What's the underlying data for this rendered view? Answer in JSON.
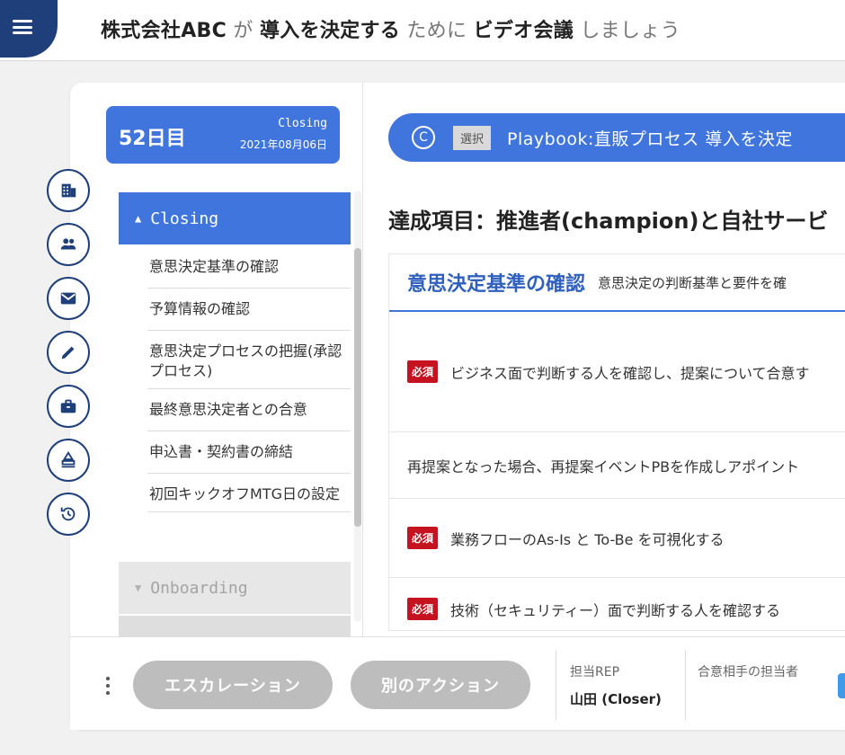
{
  "header": {
    "company": "株式会社ABC",
    "particle_ga": "が",
    "goal": "導入を決定する",
    "tameni": "ために",
    "action": "ビデオ会議",
    "suffix": "しましょう"
  },
  "rail_icons": [
    "building-icon",
    "people-icon",
    "mail-icon",
    "pencil-icon",
    "briefcase-icon",
    "stamp-icon",
    "history-icon"
  ],
  "day": {
    "count": "52日目",
    "phase": "Closing",
    "date": "2021年08月06日"
  },
  "phase_open": "Closing",
  "tasks": [
    "意思決定基準の確認",
    "予算情報の確認",
    "意思決定プロセスの把握(承認プロセス)",
    "最終意思決定者との合意",
    "申込書・契約書の締結",
    "初回キックオフMTG日の設定"
  ],
  "phase_next": "Onboarding",
  "playbook": {
    "circle_letter": "C",
    "select_tag": "選択",
    "text": "Playbook:直販プロセス  導入を決定"
  },
  "achievement": "達成項目：推進者(champion)と自社サービ",
  "section": {
    "title": "意思決定基準の確認",
    "desc": "意思決定の判断基準と要件を確"
  },
  "rows": [
    {
      "required": true,
      "badge": "必須",
      "text": "ビジネス面で判断する人を確認し、提案について合意す"
    },
    {
      "required": false,
      "badge": "",
      "text": "再提案となった場合、再提案イベントPBを作成しアポイント"
    },
    {
      "required": true,
      "badge": "必須",
      "text": "業務フローのAs-Is と To-Be を可視化する"
    },
    {
      "required": true,
      "badge": "必須",
      "text": "技術（セキュリティー）面で判断する人を確認する"
    }
  ],
  "footer": {
    "escalation": "エスカレーション",
    "other_action": "別のアクション",
    "rep_label": "担当REP",
    "rep_value": "山田 (Closer)",
    "counterpart_label": "合意相手の担当者"
  },
  "colors": {
    "primary_blue": "#3f75dc",
    "navy": "#1f3f7a",
    "required_red": "#c6121f"
  }
}
